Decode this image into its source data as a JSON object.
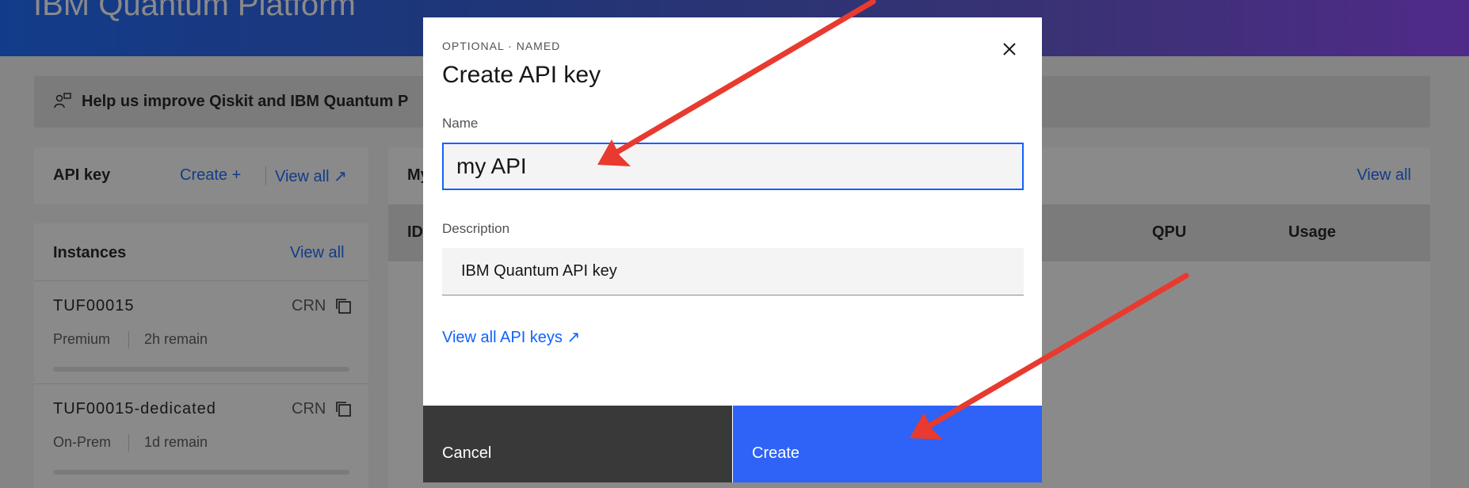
{
  "header": {
    "title": "IBM Quantum Platform"
  },
  "banner": {
    "text": "Help us improve Qiskit and IBM Quantum P",
    "icon": "feedback-person-icon"
  },
  "api_key_card": {
    "title": "API key",
    "create_label": "Create  +",
    "view_all_label": "View all  ↗"
  },
  "instances_card": {
    "title": "Instances",
    "view_all_label": "View all",
    "items": [
      {
        "name": "TUF00015",
        "crn_label": "CRN",
        "plan": "Premium",
        "remain": "2h remain"
      },
      {
        "name": "TUF00015-dedicated",
        "crn_label": "CRN",
        "plan": "On-Prem",
        "remain": "1d remain"
      }
    ]
  },
  "jobs_card": {
    "title_fragment": "My",
    "view_all_label": "View all",
    "columns": [
      "ID",
      "QPU",
      "Usage"
    ]
  },
  "modal": {
    "label": "OPTIONAL · NAMED",
    "title": "Create API key",
    "close_icon": "close-icon",
    "name_label": "Name",
    "name_value": "my API",
    "description_label": "Description",
    "description_value": "IBM Quantum API key",
    "view_all_link": "View all API keys  ↗",
    "cancel_label": "Cancel",
    "create_label": "Create"
  },
  "colors": {
    "accent": "#0f62fe",
    "primary_button": "#2f62f6",
    "secondary_button": "#393939",
    "annotation_arrow": "#e83a2f"
  }
}
